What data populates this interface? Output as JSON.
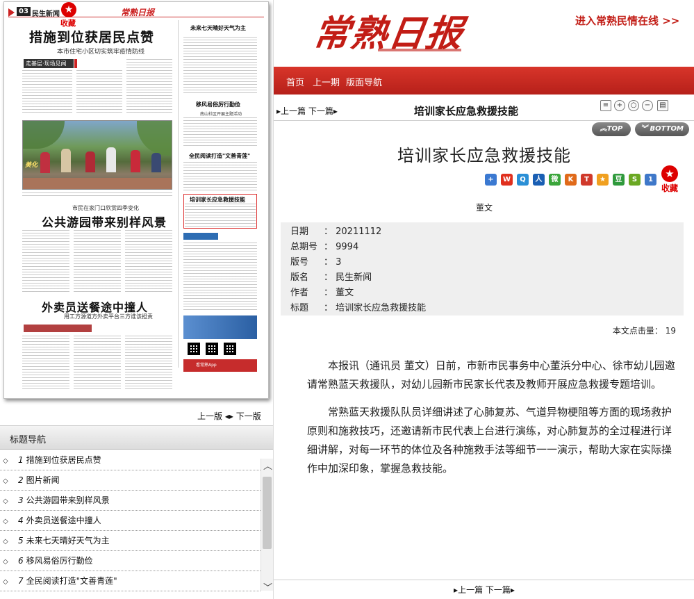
{
  "paper": {
    "page_no": "03",
    "section": "民生新闻",
    "fav_label": "收藏",
    "logo": "常熟日报",
    "headline1": "措施到位获居民点赞",
    "subhead1": "本市住宅小区切实筑牢疫情防线",
    "tag1": "走基层·现场见闻",
    "photo_caption": "美化",
    "kicker2": "市民在家门口欣赏四季变化",
    "headline2": "公共游园带来别样风景",
    "headline3": "外卖员送餐途中撞人",
    "subhead3": "用工方源道方外卖平台三方谁该担责",
    "rc_weather": "未来七天晴好天气为主",
    "rc_custom": "移风易俗厉行勤俭",
    "rc_custom_sub": "南山社区开展主题活动",
    "rc_read": "全民阅读打造\"文善青莲\"",
    "rc_first_aid": "培训家长应急救援技能",
    "rc_app": "看常熟App"
  },
  "left_pager": {
    "prev": "上一版",
    "next": "下一版"
  },
  "nav": {
    "title": "标题导航",
    "items": [
      {
        "num": "1",
        "label": "措施到位获居民点赞"
      },
      {
        "num": "2",
        "label": "图片新闻"
      },
      {
        "num": "3",
        "label": "公共游园带来别样风景"
      },
      {
        "num": "4",
        "label": "外卖员送餐途中撞人"
      },
      {
        "num": "5",
        "label": "未来七天晴好天气为主"
      },
      {
        "num": "6",
        "label": "移风易俗厉行勤俭"
      },
      {
        "num": "7",
        "label": "全民阅读打造\"文善青莲\""
      }
    ]
  },
  "site": {
    "logo": "常熟日报",
    "enter_link": "进入常熟民情在线 >>",
    "menu": [
      "首页",
      "上一期",
      "版面导航"
    ]
  },
  "article": {
    "bar_prev": "上一篇",
    "bar_next": "下一篇",
    "bar_title": "培训家长应急救援技能",
    "top_label": "TOP",
    "bottom_label": "BOTTOM",
    "title": "培训家长应急救援技能",
    "fav_label": "收藏",
    "author": "董文",
    "meta": [
      {
        "label": "日期",
        "value": "20211112"
      },
      {
        "label": "总期号",
        "value": "9994"
      },
      {
        "label": "版号",
        "value": "3"
      },
      {
        "label": "版名",
        "value": "民生新闻"
      },
      {
        "label": "作者",
        "value": "董文"
      },
      {
        "label": "标题",
        "value": "培训家长应急救援技能"
      }
    ],
    "hits_label": "本文点击量：",
    "hits": "19",
    "paragraphs": [
      "本报讯（通讯员 董文）日前，市新市民事务中心董浜分中心、徐市幼儿园邀请常熟蓝天救援队，对幼儿园新市民家长代表及教师开展应急救援专题培训。",
      "常熟蓝天救援队队员详细讲述了心肺复苏、气道异物梗阻等方面的现场救护原则和施救技巧，还邀请新市民代表上台进行演练，对心肺复苏的全过程进行详细讲解，对每一环节的体位及各种施救手法等细节一一演示，帮助大家在实际操作中加深印象，掌握急救技能。"
    ]
  },
  "share_icons": [
    {
      "name": "add",
      "color": "#3b79d1",
      "glyph": "+"
    },
    {
      "name": "weibo",
      "color": "#e0301e",
      "glyph": "W"
    },
    {
      "name": "qzone",
      "color": "#2a8fd6",
      "glyph": "Q"
    },
    {
      "name": "renren",
      "color": "#1a5fb4",
      "glyph": "人"
    },
    {
      "name": "wechat",
      "color": "#3aa53a",
      "glyph": "微"
    },
    {
      "name": "kaixin",
      "color": "#e06a1a",
      "glyph": "K"
    },
    {
      "name": "tianya",
      "color": "#d0392b",
      "glyph": "T"
    },
    {
      "name": "star",
      "color": "#f0a020",
      "glyph": "★"
    },
    {
      "name": "douban",
      "color": "#2f9a3c",
      "glyph": "豆"
    },
    {
      "name": "sohu",
      "color": "#6aa822",
      "glyph": "S"
    },
    {
      "name": "one",
      "color": "#3f78c9",
      "glyph": "1"
    }
  ],
  "tool_icons": [
    "copy-icon",
    "zoom-in-icon",
    "zoom-reset-icon",
    "zoom-out-icon",
    "print-icon"
  ]
}
